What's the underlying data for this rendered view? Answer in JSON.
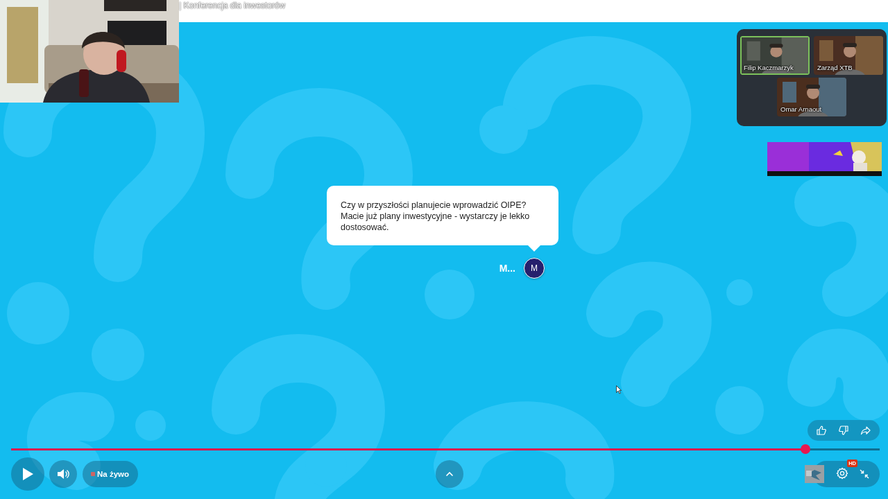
{
  "stream_title": "| Konferencja dla inwestorów",
  "participants": [
    {
      "name": "Filip Kaczmarzyk",
      "speaking": true
    },
    {
      "name": "Zarząd XTB",
      "speaking": false
    },
    {
      "name": "Omar Arnaout",
      "speaking": false
    }
  ],
  "question": {
    "text": "Czy w przyszłości planujecie wprowadzić OIPE? Macie już plany inwestycyjne - wystarczy je lekko dostosować.",
    "author": "M...",
    "avatar_initial": "M"
  },
  "progress": {
    "level": 0.9145
  },
  "live_label": "Na żywo",
  "quality_badge": "HD"
}
